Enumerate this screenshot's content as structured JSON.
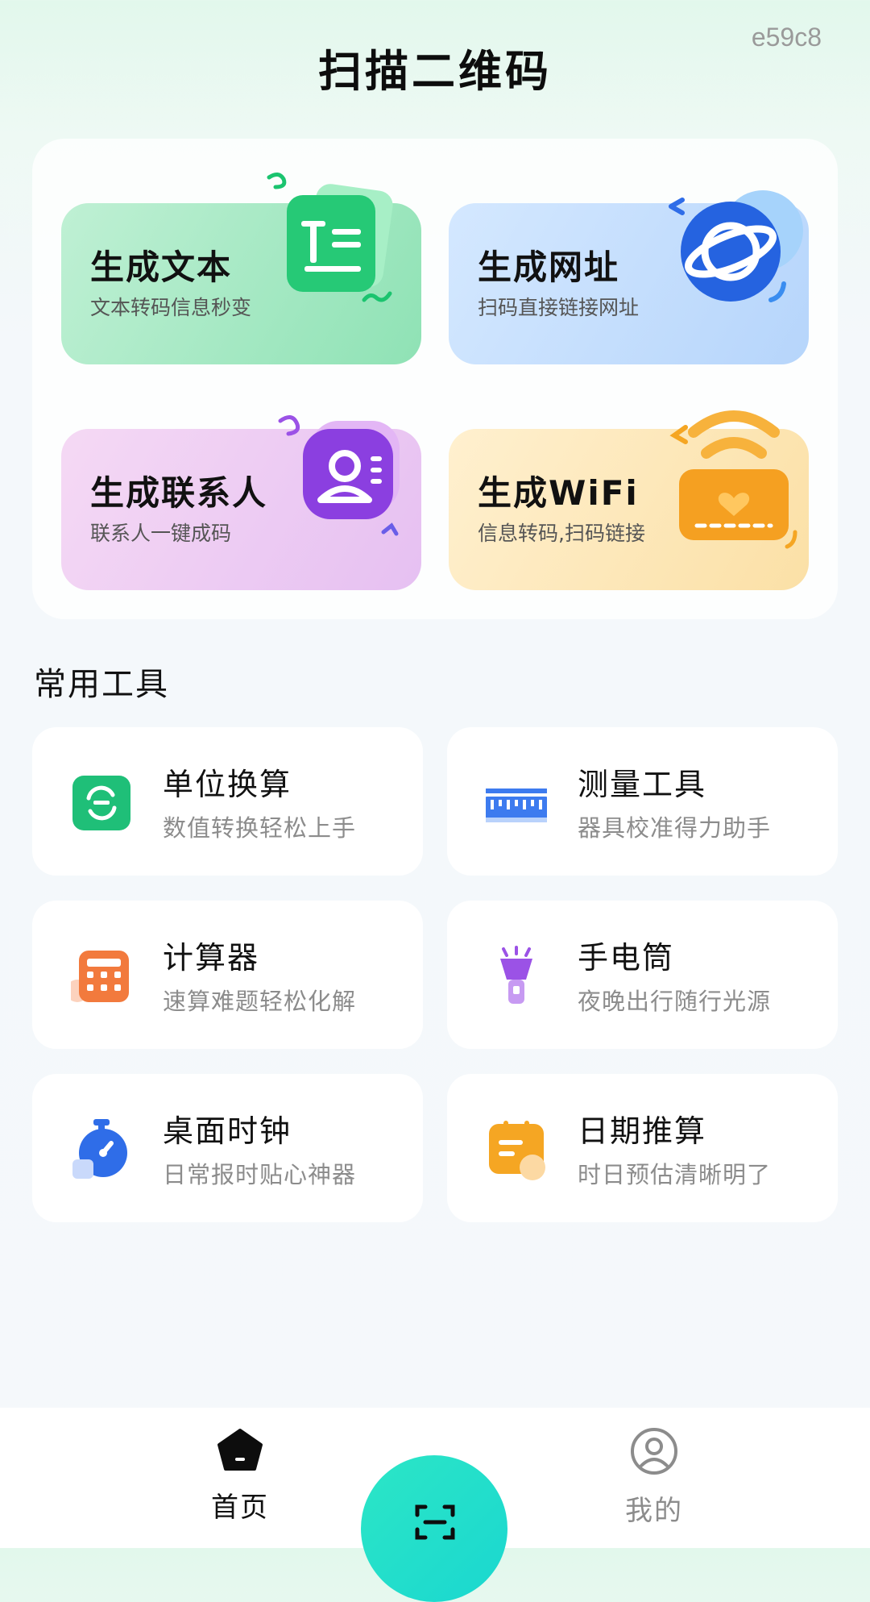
{
  "header": {
    "title": "扫描二维码",
    "code": "e59c8"
  },
  "generators": [
    {
      "name": "生成文本",
      "desc": "文本转码信息秒变",
      "icon": "text-doc-icon"
    },
    {
      "name": "生成网址",
      "desc": "扫码直接链接网址",
      "icon": "planet-link-icon"
    },
    {
      "name": "生成联系人",
      "desc": "联系人一键成码",
      "icon": "contact-card-icon"
    },
    {
      "name": "生成WiFi",
      "desc": "信息转码,扫码链接",
      "icon": "wifi-router-icon"
    }
  ],
  "tools_section": {
    "title": "常用工具"
  },
  "tools": [
    {
      "name": "单位换算",
      "desc": "数值转换轻松上手",
      "icon": "unit-convert-icon",
      "color": "#1fbf78"
    },
    {
      "name": "测量工具",
      "desc": "器具校准得力助手",
      "icon": "ruler-icon",
      "color": "#3d7bef"
    },
    {
      "name": "计算器",
      "desc": "速算难题轻松化解",
      "icon": "calculator-icon",
      "color": "#f27a3d"
    },
    {
      "name": "手电筒",
      "desc": "夜晚出行随行光源",
      "icon": "flashlight-icon",
      "color": "#9b52e6"
    },
    {
      "name": "桌面时钟",
      "desc": "日常报时贴心神器",
      "icon": "stopwatch-icon",
      "color": "#2f6de8"
    },
    {
      "name": "日期推算",
      "desc": "时日预估清晰明了",
      "icon": "calendar-note-icon",
      "color": "#f5a623"
    }
  ],
  "tabbar": {
    "home": {
      "label": "首页",
      "icon": "home-icon",
      "active": true
    },
    "scan": {
      "icon": "scan-icon"
    },
    "me": {
      "label": "我的",
      "icon": "user-icon",
      "active": false
    }
  },
  "colors": {
    "accent": "#1fd3c5",
    "active_text": "#111111",
    "inactive_text": "#8c8c8c"
  }
}
